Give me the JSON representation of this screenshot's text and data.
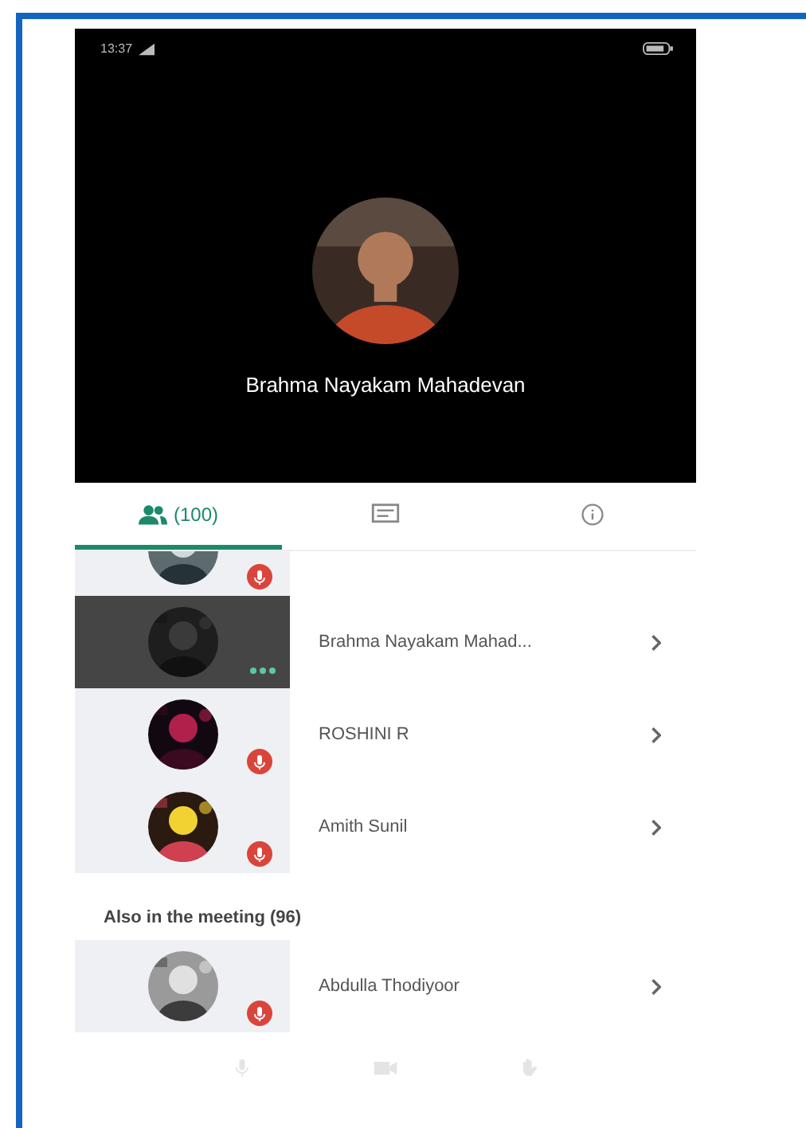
{
  "status_bar": {
    "time": "13:37"
  },
  "speaker": {
    "name": "Brahma Nayakam Mahadevan"
  },
  "tabs": [
    {
      "kind": "people",
      "label": "(100)",
      "selected": true
    },
    {
      "kind": "chat",
      "selected": false
    },
    {
      "kind": "info",
      "selected": false
    }
  ],
  "participants": [
    {
      "muted": true,
      "speaking": false
    },
    {
      "name": "Brahma Nayakam Mahad...",
      "muted": false,
      "speaking": true
    },
    {
      "name": "ROSHINI R",
      "muted": true,
      "speaking": false
    },
    {
      "name": "Amith Sunil",
      "muted": true,
      "speaking": false
    }
  ],
  "section": {
    "title": "Also in the meeting (96)"
  },
  "others": [
    {
      "name": "Abdulla Thodiyoor",
      "muted": true,
      "speaking": false
    }
  ]
}
